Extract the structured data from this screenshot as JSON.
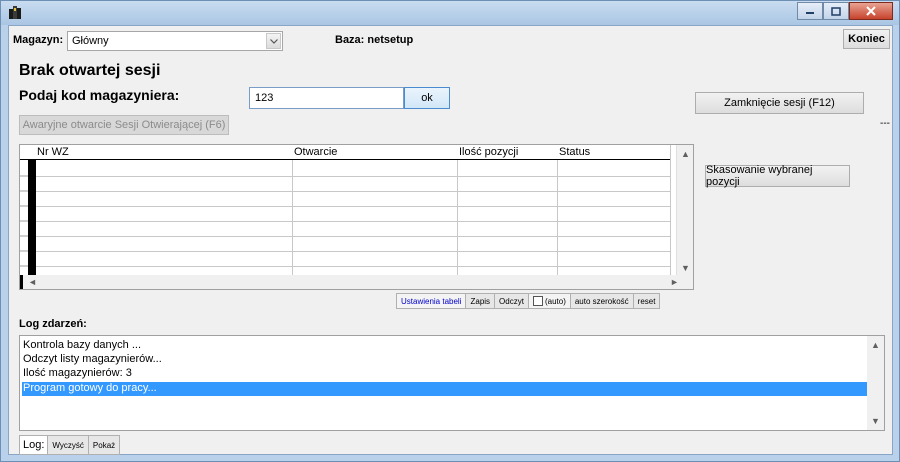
{
  "window": {
    "title": "",
    "controls": [
      "minimize-icon",
      "maximize-icon",
      "close-icon"
    ]
  },
  "toolbar": {
    "magazyn_label": "Magazyn:",
    "magazyn_value": "Główny",
    "baza_label": "Baza: netsetup",
    "koniec_label": "Koniec"
  },
  "session": {
    "heading": "Brak otwartej sesji",
    "prompt": "Podaj kod magazyniera:",
    "code_value": "123",
    "ok_label": "ok",
    "emergency_label": "Awaryjne otwarcie Sesji Otwierającej (F6)",
    "close_session_label": "Zamknięcie sesji (F12)",
    "dash": "---"
  },
  "grid": {
    "columns": [
      "Nr WZ",
      "Otwarcie",
      "Ilość pozycji",
      "Status"
    ],
    "rows": [],
    "delete_label": "Skasowanie wybranej pozycji"
  },
  "grid_tools": {
    "settings": "Ustawienia tabeli",
    "save": "Zapis",
    "read": "Odczyt",
    "auto_check": "(auto)",
    "auto_width": "auto szerokość",
    "reset": "reset"
  },
  "log": {
    "title": "Log zdarzeń:",
    "lines": [
      "Kontrola bazy danych ...",
      "Odczyt listy magazynierów...",
      "Ilość magazynierów: 3",
      "Program gotowy do pracy..."
    ],
    "selected_index": 3,
    "footer_label": "Log:",
    "clear_label": "Wyczyść",
    "show_label": "Pokaż"
  },
  "colors": {
    "selection": "#3399ff",
    "settings_link": "#0000cc"
  }
}
